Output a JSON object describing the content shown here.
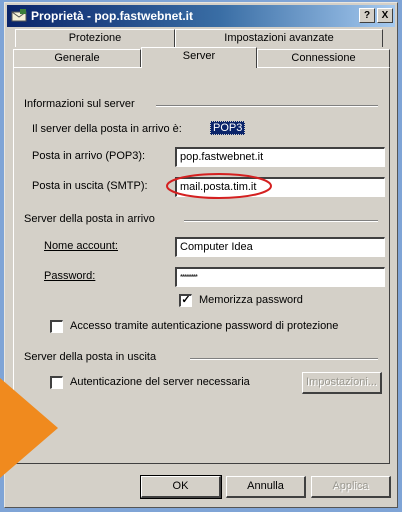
{
  "window": {
    "title": "Proprietà - pop.fastwebnet.it",
    "help_glyph": "?",
    "close_glyph": "X"
  },
  "tabs": {
    "back": [
      "Protezione",
      "Impostazioni avanzate"
    ],
    "front": [
      "Generale",
      "Server",
      "Connessione"
    ],
    "active": "Server"
  },
  "server_info": {
    "section_title": "Informazioni sul server",
    "incoming_type_label": "Il server della posta in arrivo è:",
    "incoming_type_value": "POP3",
    "incoming_label": "Posta in arrivo (POP3):",
    "incoming_value": "pop.fastwebnet.it",
    "outgoing_label": "Posta in uscita (SMTP):",
    "outgoing_value": "mail.posta.tim.it"
  },
  "incoming_server": {
    "section_title": "Server della posta in arrivo",
    "account_label": "Nome account:",
    "account_value": "Computer Idea",
    "password_label": "Password:",
    "password_value": "********",
    "remember_label": "Memorizza password",
    "remember_checked": true,
    "spa_label": "Accesso tramite autenticazione password di protezione",
    "spa_checked": false
  },
  "outgoing_server": {
    "section_title": "Server della posta in uscita",
    "auth_label": "Autenticazione del server necessaria",
    "auth_checked": false,
    "settings_button": "Impostazioni..."
  },
  "buttons": {
    "ok": "OK",
    "cancel": "Annulla",
    "apply": "Applica"
  },
  "colors": {
    "highlight_circle": "#d42020",
    "arrow": "#f08a1e",
    "background": "#7fa4d6"
  }
}
